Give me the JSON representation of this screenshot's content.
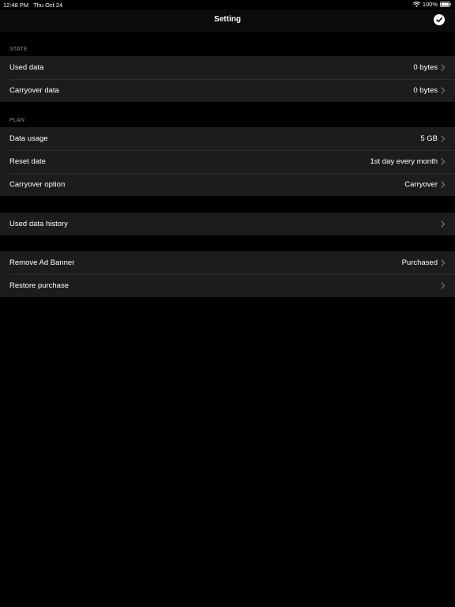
{
  "status_bar": {
    "time": "12:48 PM",
    "date": "Thu Oct 24",
    "battery": "100%",
    "icons": [
      "wifi-icon",
      "battery-icon"
    ]
  },
  "nav": {
    "title": "Setting",
    "done_icon": "checkmark-circle-icon"
  },
  "sections": {
    "state": {
      "header": "STATE",
      "rows": [
        {
          "label": "Used data",
          "value": "0 bytes"
        },
        {
          "label": "Carryover data",
          "value": "0 bytes"
        }
      ]
    },
    "plan": {
      "header": "PLAN",
      "rows": [
        {
          "label": "Data usage",
          "value": "5 GB"
        },
        {
          "label": "Reset date",
          "value": "1st day every month"
        },
        {
          "label": "Carryover option",
          "value": "Carryover"
        }
      ]
    },
    "history": {
      "rows": [
        {
          "label": "Used data history",
          "value": ""
        }
      ]
    },
    "purchase": {
      "rows": [
        {
          "label": "Remove Ad Banner",
          "value": "Purchased"
        },
        {
          "label": "Restore purchase",
          "value": ""
        }
      ]
    }
  },
  "colors": {
    "background": "#000000",
    "row_background": "#1c1c1e",
    "separator": "#2c2c2e",
    "header_text": "#8e8e93",
    "chevron": "#6d6d72"
  }
}
